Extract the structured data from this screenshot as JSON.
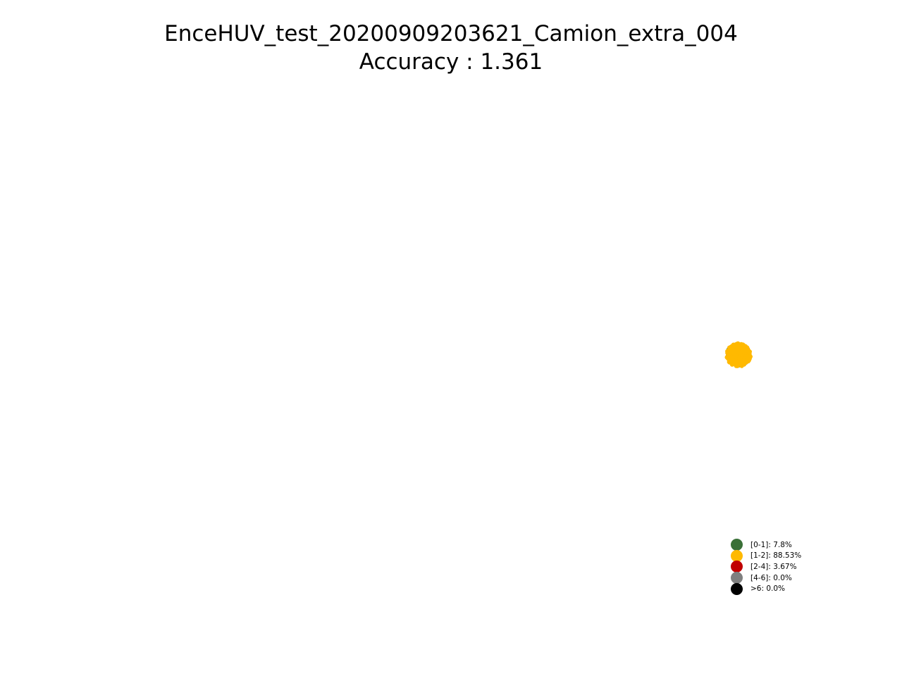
{
  "chart_data": {
    "type": "scatter",
    "title": "EnceHUV_test_20200909203621_Camion_extra_004",
    "subtitle": "Accuracy : 1.361",
    "axes_visible": false,
    "grid": false,
    "legend_position": "lower-right",
    "series": [
      {
        "name": "[0-1]: 7.8%",
        "color": "#3a7038",
        "share": 7.8
      },
      {
        "name": "[1-2]: 88.53%",
        "color": "#ffb900",
        "share": 88.53
      },
      {
        "name": "[2-4]: 3.67%",
        "color": "#c00000",
        "share": 3.67
      },
      {
        "name": "[4-6]: 0.0%",
        "color": "#7f7f7f",
        "share": 0.0
      },
      {
        "name": ">6: 0.0%",
        "color": "#000000",
        "share": 0.0
      }
    ]
  }
}
